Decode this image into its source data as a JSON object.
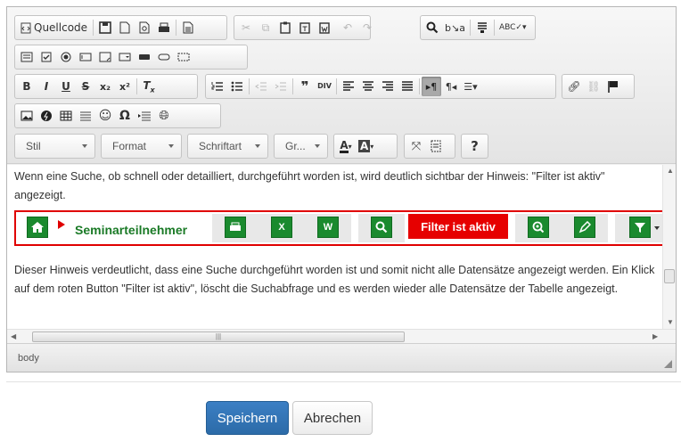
{
  "toolbar": {
    "source_label": "Quellcode",
    "style_combo": "Stil",
    "format_combo": "Format",
    "font_combo": "Schriftart",
    "size_combo": "Gr...",
    "help_label": "?"
  },
  "content": {
    "paragraph1": "Wenn eine Suche, ob schnell oder detailliert, durchgeführt worden ist, wird deutlich sichtbar der Hinweis: \"Filter ist aktiv\" angezeigt.",
    "embed_title": "Seminarteilnehmer",
    "filter_label": "Filter ist aktiv",
    "paragraph2": "Dieser Hinweis verdeutlicht, dass eine Suche durchgeführt worden ist und somit nicht alle Datensätze angezeigt werden. Ein Klick auf dem roten Button \"Filter ist aktiv\", löscht die Suchabfrage und es werden wieder alle Datensätze der Tabelle angezeigt."
  },
  "statusbar": {
    "path": "body"
  },
  "actions": {
    "save_label": "Speichern",
    "cancel_label": "Abrechen"
  },
  "colors": {
    "accent_green": "#1a8a2e",
    "filter_red": "#e60000",
    "save_blue": "#2c6ba8"
  }
}
